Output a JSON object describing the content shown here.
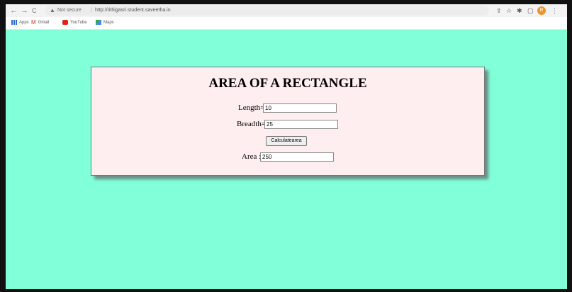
{
  "browser": {
    "nav_back": "←",
    "nav_forward": "→",
    "nav_reload": "C",
    "security_label": "Not secure",
    "url": "http://rithigasri.student.saveetha.in",
    "profile_initial": "R"
  },
  "bookmarks": [
    {
      "label": "Apps",
      "icon": "apps-icon",
      "color": "#2f6bd7"
    },
    {
      "label": "Gmail",
      "icon": "gmail-icon",
      "color": "#d93025"
    },
    {
      "label": "YouTube",
      "icon": "youtube-icon",
      "color": "#e62117"
    },
    {
      "label": "Maps",
      "icon": "maps-icon",
      "color": "#34a853"
    }
  ],
  "page": {
    "background": "#80ffd8",
    "card_background": "#ffeef0",
    "title": "AREA OF A RECTANGLE",
    "length_label": "Length=",
    "length_value": "10",
    "breadth_label": "Breadth=",
    "breadth_value": "25",
    "button_label": "Calculatearea",
    "area_label": "Area :",
    "area_value": "250"
  }
}
